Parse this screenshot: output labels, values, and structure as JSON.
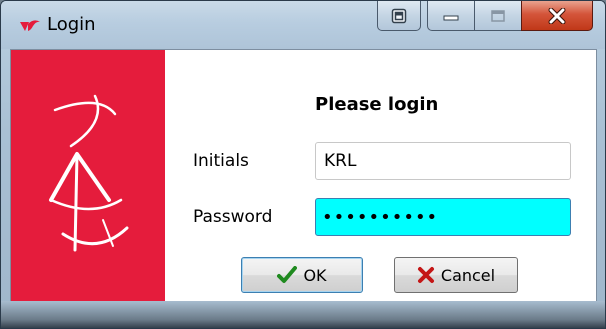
{
  "window": {
    "title": "Login"
  },
  "titlebar": {
    "extra_button_icon": "restore-window-icon",
    "minimize_icon": "minimize-icon",
    "maximize_icon": "maximize-icon",
    "close_icon": "close-icon"
  },
  "logo": {
    "icon": "company-logo",
    "background_color": "#e51c3c"
  },
  "form": {
    "heading": "Please login",
    "initials_label": "Initials",
    "initials_value": "KRL",
    "password_label": "Password",
    "password_value": "••••••••••",
    "password_bg_color": "#00ffff"
  },
  "buttons": {
    "ok_label": "OK",
    "ok_icon": "checkmark-icon",
    "cancel_label": "Cancel",
    "cancel_icon": "x-icon"
  }
}
